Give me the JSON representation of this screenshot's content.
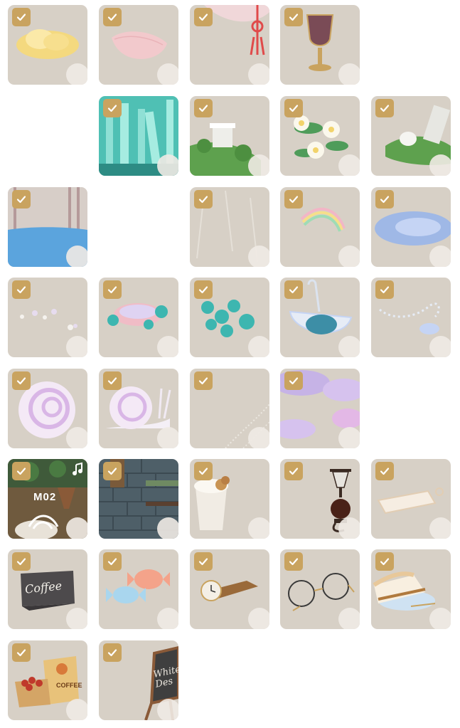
{
  "grid": {
    "items": [
      {
        "name": "cloud",
        "checked": true,
        "empty": false
      },
      {
        "name": "petal",
        "checked": true,
        "empty": false
      },
      {
        "name": "curtain-ribbon",
        "checked": true,
        "empty": false
      },
      {
        "name": "goblet",
        "checked": true,
        "empty": false
      },
      {
        "name": "",
        "checked": false,
        "empty": true
      },
      {
        "name": "",
        "checked": false,
        "empty": true
      },
      {
        "name": "teal-pillars",
        "checked": true,
        "empty": false
      },
      {
        "name": "pillar-ruin",
        "checked": true,
        "empty": false
      },
      {
        "name": "water-lilies",
        "checked": true,
        "empty": false
      },
      {
        "name": "broken-column",
        "checked": true,
        "empty": false
      },
      {
        "name": "pool",
        "checked": true,
        "empty": false
      },
      {
        "name": "",
        "checked": false,
        "empty": true
      },
      {
        "name": "rain",
        "checked": true,
        "empty": false
      },
      {
        "name": "rainbow",
        "checked": true,
        "empty": false
      },
      {
        "name": "puddle",
        "checked": true,
        "empty": false
      },
      {
        "name": "bubbles",
        "checked": true,
        "empty": false
      },
      {
        "name": "flower-basin",
        "checked": true,
        "empty": false
      },
      {
        "name": "clover-leaves",
        "checked": true,
        "empty": false
      },
      {
        "name": "umbrella",
        "checked": true,
        "empty": false
      },
      {
        "name": "pearl-string",
        "checked": true,
        "empty": false
      },
      {
        "name": "shell",
        "checked": true,
        "empty": false
      },
      {
        "name": "snail",
        "checked": true,
        "empty": false
      },
      {
        "name": "cobweb",
        "checked": true,
        "empty": false
      },
      {
        "name": "purple-haze",
        "checked": true,
        "empty": false
      },
      {
        "name": "",
        "checked": false,
        "empty": true
      },
      {
        "name": "cafe-scene-music",
        "checked": true,
        "empty": false
      },
      {
        "name": "brick-wall-cafe",
        "checked": true,
        "empty": false
      },
      {
        "name": "latte-cup",
        "checked": true,
        "empty": false
      },
      {
        "name": "siphon-coffee-maker",
        "checked": true,
        "empty": false
      },
      {
        "name": "cutting-board",
        "checked": true,
        "empty": false
      },
      {
        "name": "coffee-sign",
        "checked": true,
        "empty": false
      },
      {
        "name": "candies",
        "checked": true,
        "empty": false
      },
      {
        "name": "pocket-watch",
        "checked": true,
        "empty": false
      },
      {
        "name": "glasses",
        "checked": true,
        "empty": false
      },
      {
        "name": "cake-slice",
        "checked": true,
        "empty": false
      },
      {
        "name": "coffee-beans-sack",
        "checked": true,
        "empty": false
      },
      {
        "name": "chalkboard",
        "checked": true,
        "empty": false
      }
    ]
  },
  "texts": {
    "m02": "M02",
    "coffee_sign": "Coffee",
    "coffee_sack": "COFFEE",
    "board": "White\nDes"
  },
  "colors": {
    "tile_bg": "#d7d0c6",
    "check_bg": "#c9a35f",
    "check_mark": "#ffffff"
  }
}
